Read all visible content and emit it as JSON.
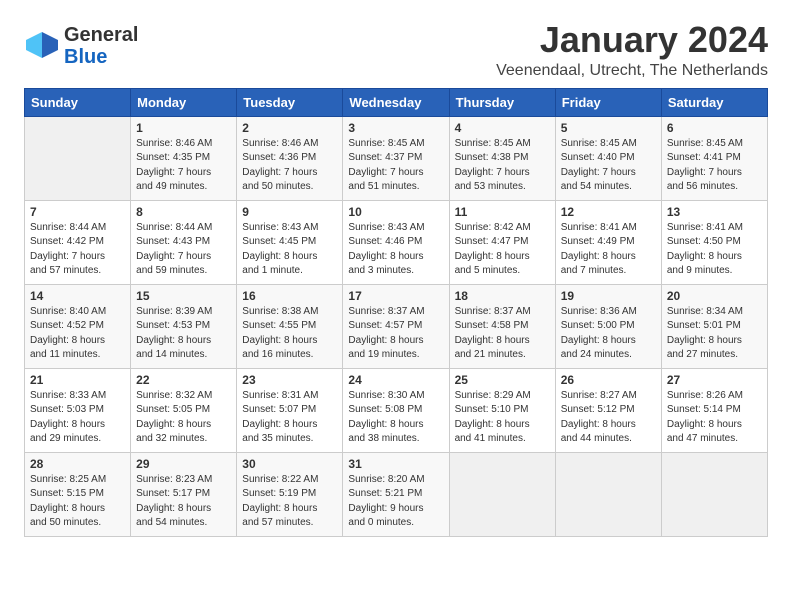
{
  "header": {
    "logo_general": "General",
    "logo_blue": "Blue",
    "title": "January 2024",
    "location": "Veenendaal, Utrecht, The Netherlands"
  },
  "days_of_week": [
    "Sunday",
    "Monday",
    "Tuesday",
    "Wednesday",
    "Thursday",
    "Friday",
    "Saturday"
  ],
  "weeks": [
    [
      {
        "day": "",
        "content": ""
      },
      {
        "day": "1",
        "content": "Sunrise: 8:46 AM\nSunset: 4:35 PM\nDaylight: 7 hours\nand 49 minutes."
      },
      {
        "day": "2",
        "content": "Sunrise: 8:46 AM\nSunset: 4:36 PM\nDaylight: 7 hours\nand 50 minutes."
      },
      {
        "day": "3",
        "content": "Sunrise: 8:45 AM\nSunset: 4:37 PM\nDaylight: 7 hours\nand 51 minutes."
      },
      {
        "day": "4",
        "content": "Sunrise: 8:45 AM\nSunset: 4:38 PM\nDaylight: 7 hours\nand 53 minutes."
      },
      {
        "day": "5",
        "content": "Sunrise: 8:45 AM\nSunset: 4:40 PM\nDaylight: 7 hours\nand 54 minutes."
      },
      {
        "day": "6",
        "content": "Sunrise: 8:45 AM\nSunset: 4:41 PM\nDaylight: 7 hours\nand 56 minutes."
      }
    ],
    [
      {
        "day": "7",
        "content": "Sunrise: 8:44 AM\nSunset: 4:42 PM\nDaylight: 7 hours\nand 57 minutes."
      },
      {
        "day": "8",
        "content": "Sunrise: 8:44 AM\nSunset: 4:43 PM\nDaylight: 7 hours\nand 59 minutes."
      },
      {
        "day": "9",
        "content": "Sunrise: 8:43 AM\nSunset: 4:45 PM\nDaylight: 8 hours\nand 1 minute."
      },
      {
        "day": "10",
        "content": "Sunrise: 8:43 AM\nSunset: 4:46 PM\nDaylight: 8 hours\nand 3 minutes."
      },
      {
        "day": "11",
        "content": "Sunrise: 8:42 AM\nSunset: 4:47 PM\nDaylight: 8 hours\nand 5 minutes."
      },
      {
        "day": "12",
        "content": "Sunrise: 8:41 AM\nSunset: 4:49 PM\nDaylight: 8 hours\nand 7 minutes."
      },
      {
        "day": "13",
        "content": "Sunrise: 8:41 AM\nSunset: 4:50 PM\nDaylight: 8 hours\nand 9 minutes."
      }
    ],
    [
      {
        "day": "14",
        "content": "Sunrise: 8:40 AM\nSunset: 4:52 PM\nDaylight: 8 hours\nand 11 minutes."
      },
      {
        "day": "15",
        "content": "Sunrise: 8:39 AM\nSunset: 4:53 PM\nDaylight: 8 hours\nand 14 minutes."
      },
      {
        "day": "16",
        "content": "Sunrise: 8:38 AM\nSunset: 4:55 PM\nDaylight: 8 hours\nand 16 minutes."
      },
      {
        "day": "17",
        "content": "Sunrise: 8:37 AM\nSunset: 4:57 PM\nDaylight: 8 hours\nand 19 minutes."
      },
      {
        "day": "18",
        "content": "Sunrise: 8:37 AM\nSunset: 4:58 PM\nDaylight: 8 hours\nand 21 minutes."
      },
      {
        "day": "19",
        "content": "Sunrise: 8:36 AM\nSunset: 5:00 PM\nDaylight: 8 hours\nand 24 minutes."
      },
      {
        "day": "20",
        "content": "Sunrise: 8:34 AM\nSunset: 5:01 PM\nDaylight: 8 hours\nand 27 minutes."
      }
    ],
    [
      {
        "day": "21",
        "content": "Sunrise: 8:33 AM\nSunset: 5:03 PM\nDaylight: 8 hours\nand 29 minutes."
      },
      {
        "day": "22",
        "content": "Sunrise: 8:32 AM\nSunset: 5:05 PM\nDaylight: 8 hours\nand 32 minutes."
      },
      {
        "day": "23",
        "content": "Sunrise: 8:31 AM\nSunset: 5:07 PM\nDaylight: 8 hours\nand 35 minutes."
      },
      {
        "day": "24",
        "content": "Sunrise: 8:30 AM\nSunset: 5:08 PM\nDaylight: 8 hours\nand 38 minutes."
      },
      {
        "day": "25",
        "content": "Sunrise: 8:29 AM\nSunset: 5:10 PM\nDaylight: 8 hours\nand 41 minutes."
      },
      {
        "day": "26",
        "content": "Sunrise: 8:27 AM\nSunset: 5:12 PM\nDaylight: 8 hours\nand 44 minutes."
      },
      {
        "day": "27",
        "content": "Sunrise: 8:26 AM\nSunset: 5:14 PM\nDaylight: 8 hours\nand 47 minutes."
      }
    ],
    [
      {
        "day": "28",
        "content": "Sunrise: 8:25 AM\nSunset: 5:15 PM\nDaylight: 8 hours\nand 50 minutes."
      },
      {
        "day": "29",
        "content": "Sunrise: 8:23 AM\nSunset: 5:17 PM\nDaylight: 8 hours\nand 54 minutes."
      },
      {
        "day": "30",
        "content": "Sunrise: 8:22 AM\nSunset: 5:19 PM\nDaylight: 8 hours\nand 57 minutes."
      },
      {
        "day": "31",
        "content": "Sunrise: 8:20 AM\nSunset: 5:21 PM\nDaylight: 9 hours\nand 0 minutes."
      },
      {
        "day": "",
        "content": ""
      },
      {
        "day": "",
        "content": ""
      },
      {
        "day": "",
        "content": ""
      }
    ]
  ]
}
